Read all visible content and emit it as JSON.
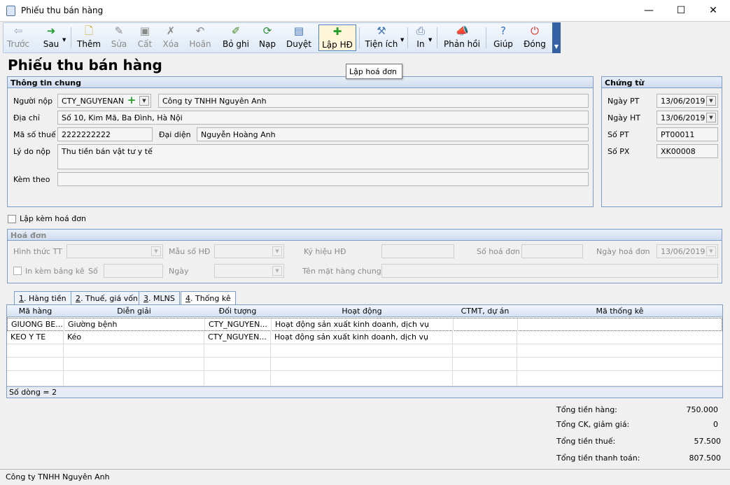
{
  "window": {
    "title": "Phiếu thu bán hàng",
    "minimize": "—",
    "maximize": "☐",
    "close": "✕"
  },
  "toolbar": {
    "prev": "Trước",
    "next": "Sau",
    "add": "Thêm",
    "edit": "Sửa",
    "save": "Cất",
    "delete": "Xóa",
    "undo": "Hoãn",
    "unpost": "Bỏ ghi",
    "load": "Nạp",
    "approve": "Duyệt",
    "invoice": "Lập HĐ",
    "utilities": "Tiện ích",
    "print": "In",
    "feedback": "Phản hồi",
    "help": "Giúp",
    "close": "Đóng"
  },
  "tooltip": "Lập hoá đơn",
  "heading": "Phiếu thu bán hàng",
  "general": {
    "title": "Thông tin chung",
    "payer_label": "Người nộp",
    "payer_code": "CTY_NGUYENAN",
    "payer_name": "Công ty TNHH Nguyên Anh",
    "address_label": "Địa chỉ",
    "address": "Số 10, Kim Mã, Ba Đình, Hà Nội",
    "tax_label": "Mã số thuế",
    "tax_code": "2222222222",
    "rep_label": "Đại diện",
    "rep": "Nguyễn Hoàng Anh",
    "reason_label": "Lý do nộp",
    "reason": "Thu tiền bán vật tư y tế",
    "attach_label": "Kèm theo",
    "attach": ""
  },
  "voucher": {
    "title": "Chứng từ",
    "date_pt_label": "Ngày PT",
    "date_pt": "13/06/2019",
    "date_ht_label": "Ngày HT",
    "date_ht": "13/06/2019",
    "no_pt_label": "Số PT",
    "no_pt": "PT00011",
    "no_px_label": "Số PX",
    "no_px": "XK00008"
  },
  "with_invoice_label": "Lập kèm hoá đơn",
  "invoice": {
    "title": "Hoá đơn",
    "form_label": "Hình thức TT",
    "template_label": "Mẫu số HĐ",
    "symbol_label": "Ký hiệu HĐ",
    "number_label": "Số hoá đơn",
    "date_label": "Ngày hoá đơn",
    "date": "13/06/2019",
    "print_list_label": "In kèm bảng kê",
    "list_no_label": "Số",
    "list_date_label": "Ngày",
    "common_item_label": "Tên mặt hàng chung"
  },
  "tabs": [
    {
      "num": "1",
      "label": ". Hàng tiền"
    },
    {
      "num": "2",
      "label": ". Thuế, giá vốn"
    },
    {
      "num": "3",
      "label": ". MLNS"
    },
    {
      "num": "4",
      "label": ". Thống kê"
    }
  ],
  "grid": {
    "columns": [
      "Mã hàng",
      "Diễn giải",
      "Đối tượng",
      "Hoạt động",
      "CTMT, dự án",
      "Mã thống kê"
    ],
    "rows": [
      [
        "GIUONG BE...",
        "Giường bệnh",
        "CTY_NGUYEN...",
        "Hoạt động sản xuất kinh doanh, dịch vụ",
        "",
        ""
      ],
      [
        "KEO Y TE",
        "Kéo",
        "CTY_NGUYEN...",
        "Hoạt động sản xuất kinh doanh, dịch vụ",
        "",
        ""
      ]
    ],
    "footer": "Số dòng = 2"
  },
  "totals": {
    "goods_label": "Tổng tiền hàng:",
    "goods": "750.000",
    "discount_label": "Tổng CK, giảm giá:",
    "discount": "0",
    "tax_label": "Tổng tiền thuế:",
    "tax": "57.500",
    "pay_label": "Tổng tiền thanh toán:",
    "pay": "807.500"
  },
  "status": "Công ty TNHH Nguyên Anh"
}
